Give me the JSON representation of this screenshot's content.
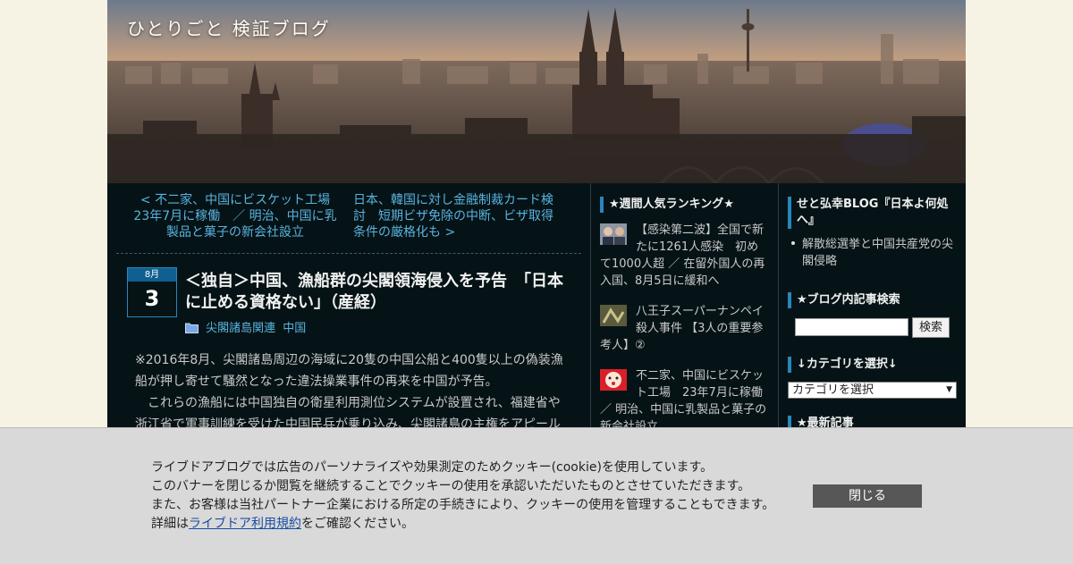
{
  "site": {
    "title": "ひとりごと 検証ブログ"
  },
  "post_nav": {
    "prev": "< 不二家、中国にビスケット工場　23年7月に稼働　／ 明治、中国に乳製品と菓子の新会社設立",
    "next": "日本、韓国に対し金融制裁カード検討　短期ビザ免除の中断、ビザ取得条件の厳格化も >"
  },
  "post": {
    "date_month": "8月",
    "date_day": "3",
    "title": "＜独自＞中国、漁船群の尖閣領海侵入を予告　「日本に止める資格ない」（産経）",
    "categories": [
      "尖閣諸島関連",
      "中国"
    ],
    "body": [
      "※2016年8月、尖閣諸島周辺の海域に20隻の中国公船と400隻以上の偽装漁船が押し寄せて騒然となった違法操業事件の再来を中国が予告。",
      "　これらの漁船には中国独自の衛星利用測位システムが設置され、福建省や浙江省で軍事訓練を受けた中国民兵が乗り込み、尖閣諸島の主権をアピール"
    ]
  },
  "ranking": {
    "title": "★週間人気ランキング★",
    "items": [
      {
        "text": "【感染第二波】全国で新たに1261人感染　初めて1000人超 ／ 在留外国人の再入国、8月5日に緩和へ"
      },
      {
        "text": "八王子スーパーナンペイ殺人事件 【3人の重要参考人】②"
      },
      {
        "text": "不二家、中国にビスケット工場　23年7月に稼働　／ 明治、中国に乳製品と菓子の新会社設立"
      }
    ]
  },
  "sidebar": {
    "blog_title": "せと弘幸BLOG『日本よ何処へ』",
    "blog_link": "解散総選挙と中国共産党の尖閣侵略",
    "search_title": "★ブログ内記事検索",
    "search_button": "検索",
    "category_title": "↓カテゴリを選択↓",
    "category_select": "カテゴリを選択",
    "recent_title": "★最新記事"
  },
  "cookie": {
    "line1": "ライブドアブログでは広告のパーソナライズや効果測定のためクッキー(cookie)を使用しています。",
    "line2": "このバナーを閉じるか閲覧を継続することでクッキーの使用を承認いただいたものとさせていただきます。",
    "line3": "また、お客様は当社パートナー企業における所定の手続きにより、クッキーの使用を管理することもできます。",
    "line4_prefix": "詳細は",
    "link": "ライブドア利用規約",
    "line4_suffix": "をご確認ください。",
    "close_button": "閉じる"
  },
  "colors": {
    "page_bg": "#f6f3e4",
    "content_bg": "#061316",
    "link": "#59b3e0",
    "accent": "#2a86bd",
    "cookie_bg": "#d9d9d9",
    "close_button_bg": "#575757"
  }
}
